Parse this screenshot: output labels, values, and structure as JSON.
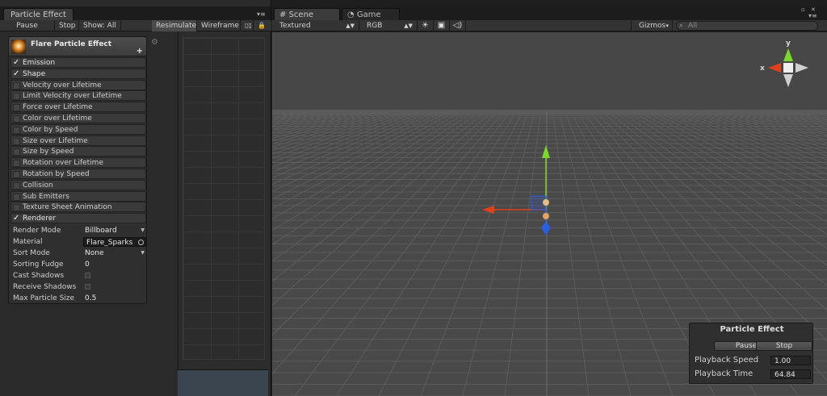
{
  "left_window": {
    "tab_title": "Particle Effect",
    "toolbar": {
      "pause": "Pause",
      "stop": "Stop",
      "show": "Show: All",
      "resimulate": "Resimulate",
      "wireframe": "Wireframe"
    },
    "effect_name": "Flare Particle Effect",
    "modules": [
      {
        "label": "Emission",
        "enabled": true
      },
      {
        "label": "Shape",
        "enabled": true
      },
      {
        "label": "Velocity over Lifetime",
        "enabled": false
      },
      {
        "label": "Limit Velocity over Lifetime",
        "enabled": false
      },
      {
        "label": "Force over Lifetime",
        "enabled": false
      },
      {
        "label": "Color over Lifetime",
        "enabled": false
      },
      {
        "label": "Color by Speed",
        "enabled": false
      },
      {
        "label": "Size over Lifetime",
        "enabled": false
      },
      {
        "label": "Size by Speed",
        "enabled": false
      },
      {
        "label": "Rotation over Lifetime",
        "enabled": false
      },
      {
        "label": "Rotation by Speed",
        "enabled": false
      },
      {
        "label": "Collision",
        "enabled": false
      },
      {
        "label": "Sub Emitters",
        "enabled": false
      },
      {
        "label": "Texture Sheet Animation",
        "enabled": false
      },
      {
        "label": "Renderer",
        "enabled": true
      }
    ],
    "renderer": {
      "render_mode_label": "Render Mode",
      "render_mode_value": "Billboard",
      "material_label": "Material",
      "material_value": "Flare_Sparks",
      "sort_mode_label": "Sort Mode",
      "sort_mode_value": "None",
      "sorting_fudge_label": "Sorting Fudge",
      "sorting_fudge_value": "0",
      "cast_shadows_label": "Cast Shadows",
      "receive_shadows_label": "Receive Shadows",
      "max_particle_size_label": "Max Particle Size",
      "max_particle_size_value": "0.5"
    }
  },
  "right_window": {
    "tabs": [
      "Scene",
      "Game"
    ],
    "toolbar": {
      "shading": "Textured",
      "channel": "RGB",
      "gizmos": "Gizmos",
      "search_placeholder": "All"
    },
    "orientation_gizmo": {
      "x_label": "x",
      "y_label": "y"
    },
    "particle_panel": {
      "title": "Particle Effect",
      "pause": "Pause",
      "stop": "Stop",
      "playback_speed_label": "Playback Speed",
      "playback_speed_value": "1.00",
      "playback_time_label": "Playback Time",
      "playback_time_value": "64.84"
    }
  },
  "colors": {
    "x_axis": "#e0401c",
    "y_axis": "#7dd62e",
    "z_axis": "#2a5fe0",
    "viewport_bg": "#494949"
  }
}
